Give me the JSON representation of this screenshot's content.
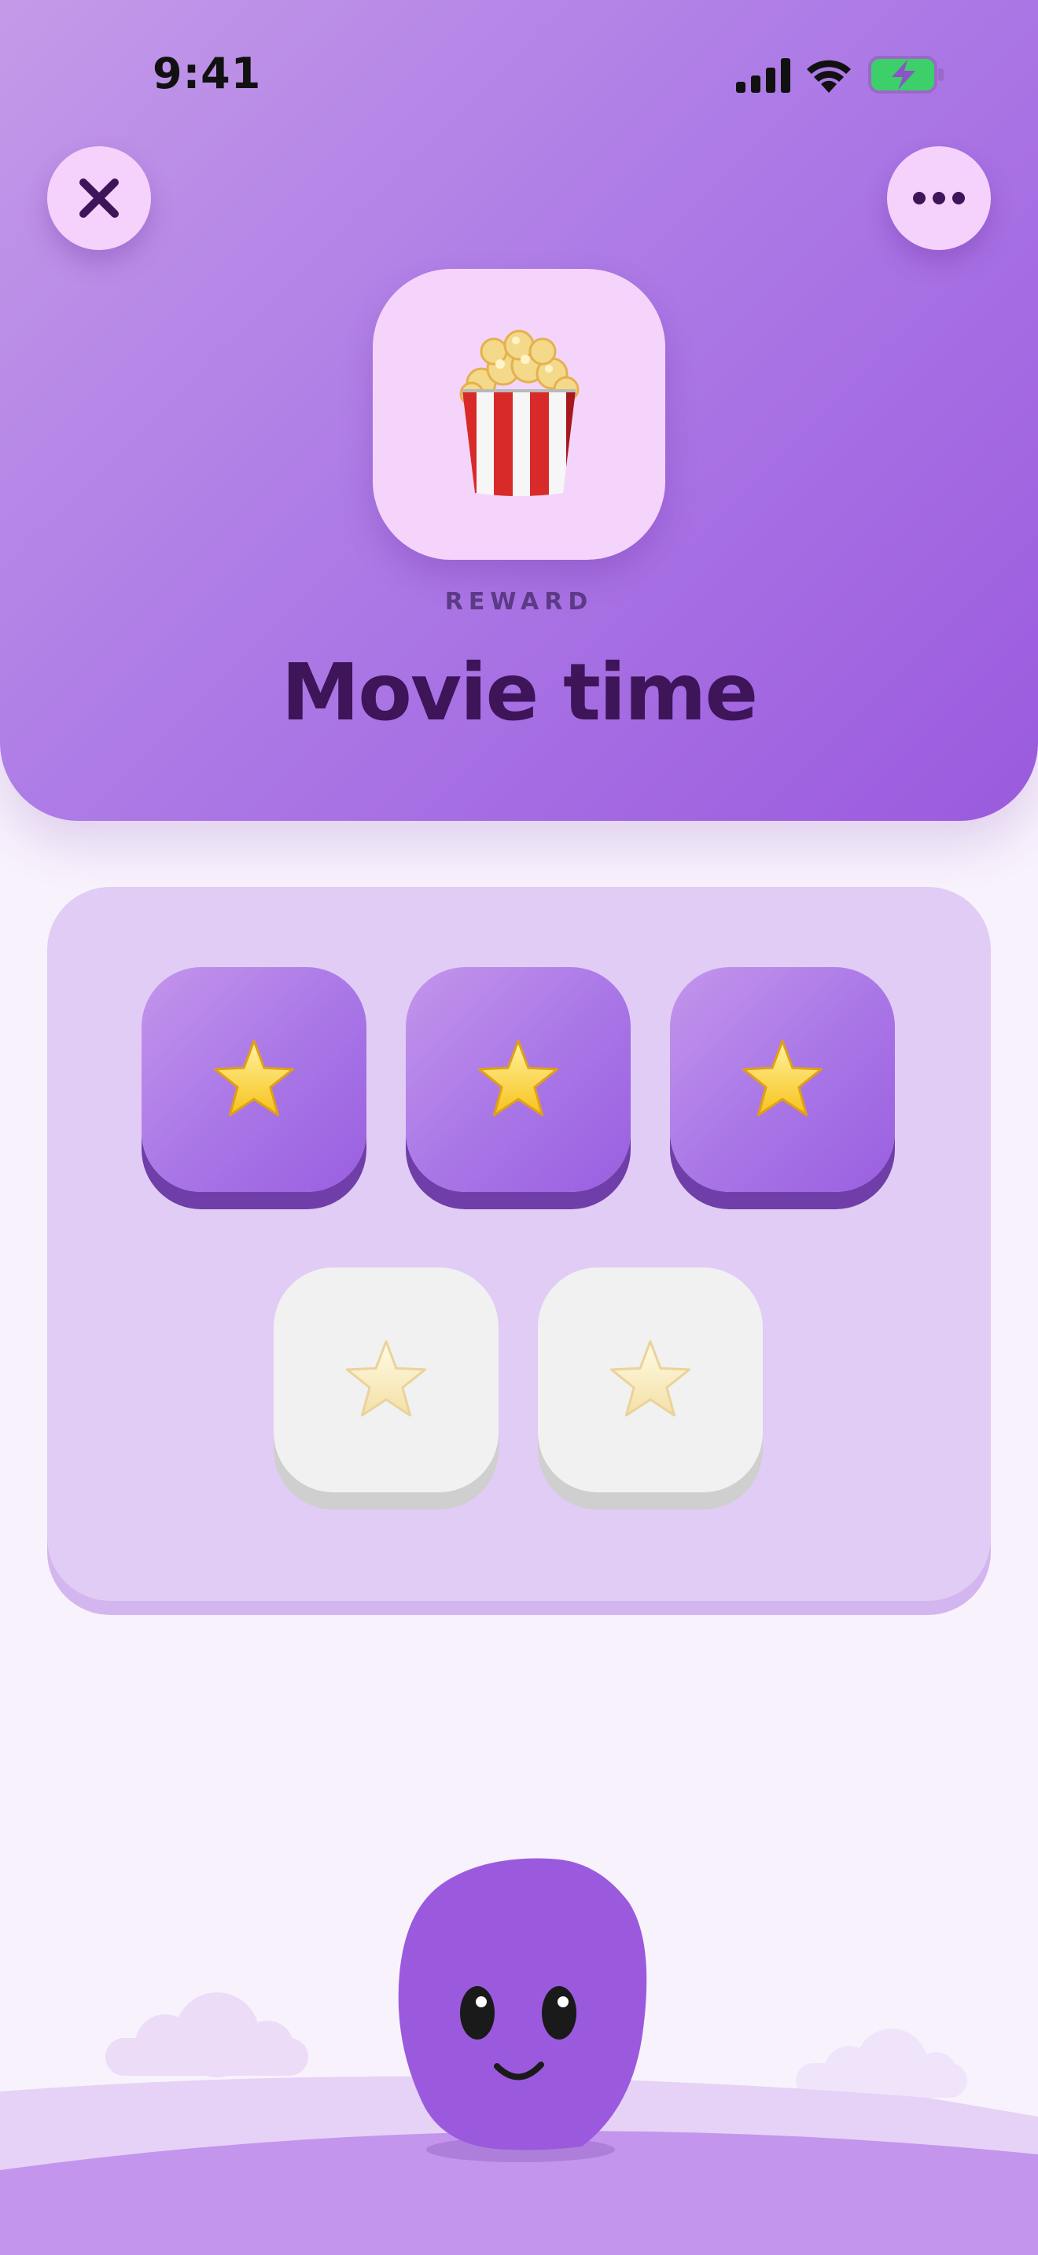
{
  "status_bar": {
    "time": "9:41",
    "icons": [
      "cellular-signal-icon",
      "wifi-icon",
      "battery-charging-icon"
    ]
  },
  "header": {
    "close_icon": "close-icon",
    "more_icon": "more-icon",
    "reward_icon": "popcorn-icon",
    "label": "REWARD",
    "title": "Movie time"
  },
  "progress": {
    "stars_earned": 3,
    "stars_total": 5,
    "stars": [
      {
        "state": "earned"
      },
      {
        "state": "earned"
      },
      {
        "state": "earned"
      },
      {
        "state": "empty"
      },
      {
        "state": "empty"
      }
    ]
  },
  "mascot": {
    "icon": "smiling-blob-mascot",
    "color": "#9b5ade"
  },
  "colors": {
    "accent": "#9b5ade",
    "title": "#3d1558",
    "panel": "#e1ccf5",
    "background": "#f8f2fc"
  }
}
